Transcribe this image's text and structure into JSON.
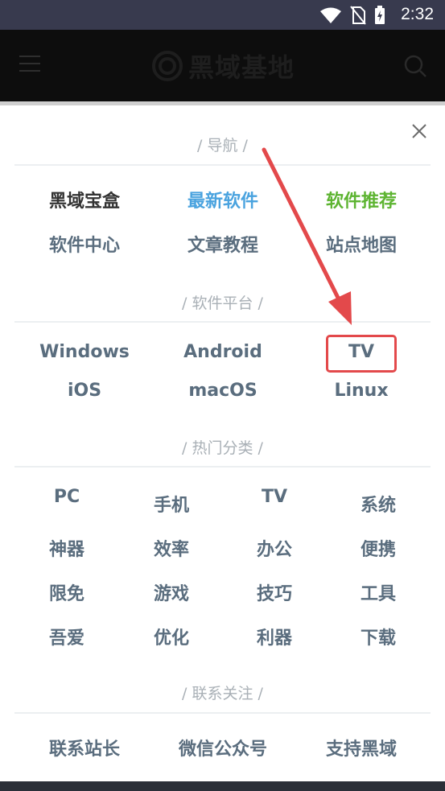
{
  "status": {
    "time": "2:32"
  },
  "app": {
    "logo_text": "黑域基地"
  },
  "nav": {
    "title": "/ 导航 /",
    "items": [
      "黑域宝盒",
      "最新软件",
      "软件推荐",
      "软件中心",
      "文章教程",
      "站点地图"
    ]
  },
  "platforms": {
    "title": "/ 软件平台 /",
    "items": [
      "Windows",
      "Android",
      "TV",
      "iOS",
      "macOS",
      "Linux"
    ]
  },
  "categories": {
    "title": "/ 热门分类 /",
    "items": [
      "PC",
      "手机",
      "TV",
      "系统",
      "神器",
      "效率",
      "办公",
      "便携",
      "限免",
      "游戏",
      "技巧",
      "工具",
      "吾爱",
      "优化",
      "利器",
      "下载"
    ]
  },
  "contact": {
    "title": "/ 联系关注 /",
    "items": [
      "联系站长",
      "微信公众号",
      "支持黑域"
    ]
  },
  "colors": {
    "accent_blue": "#4aa3df",
    "accent_green": "#5db431",
    "annotation_red": "#e3494b"
  }
}
